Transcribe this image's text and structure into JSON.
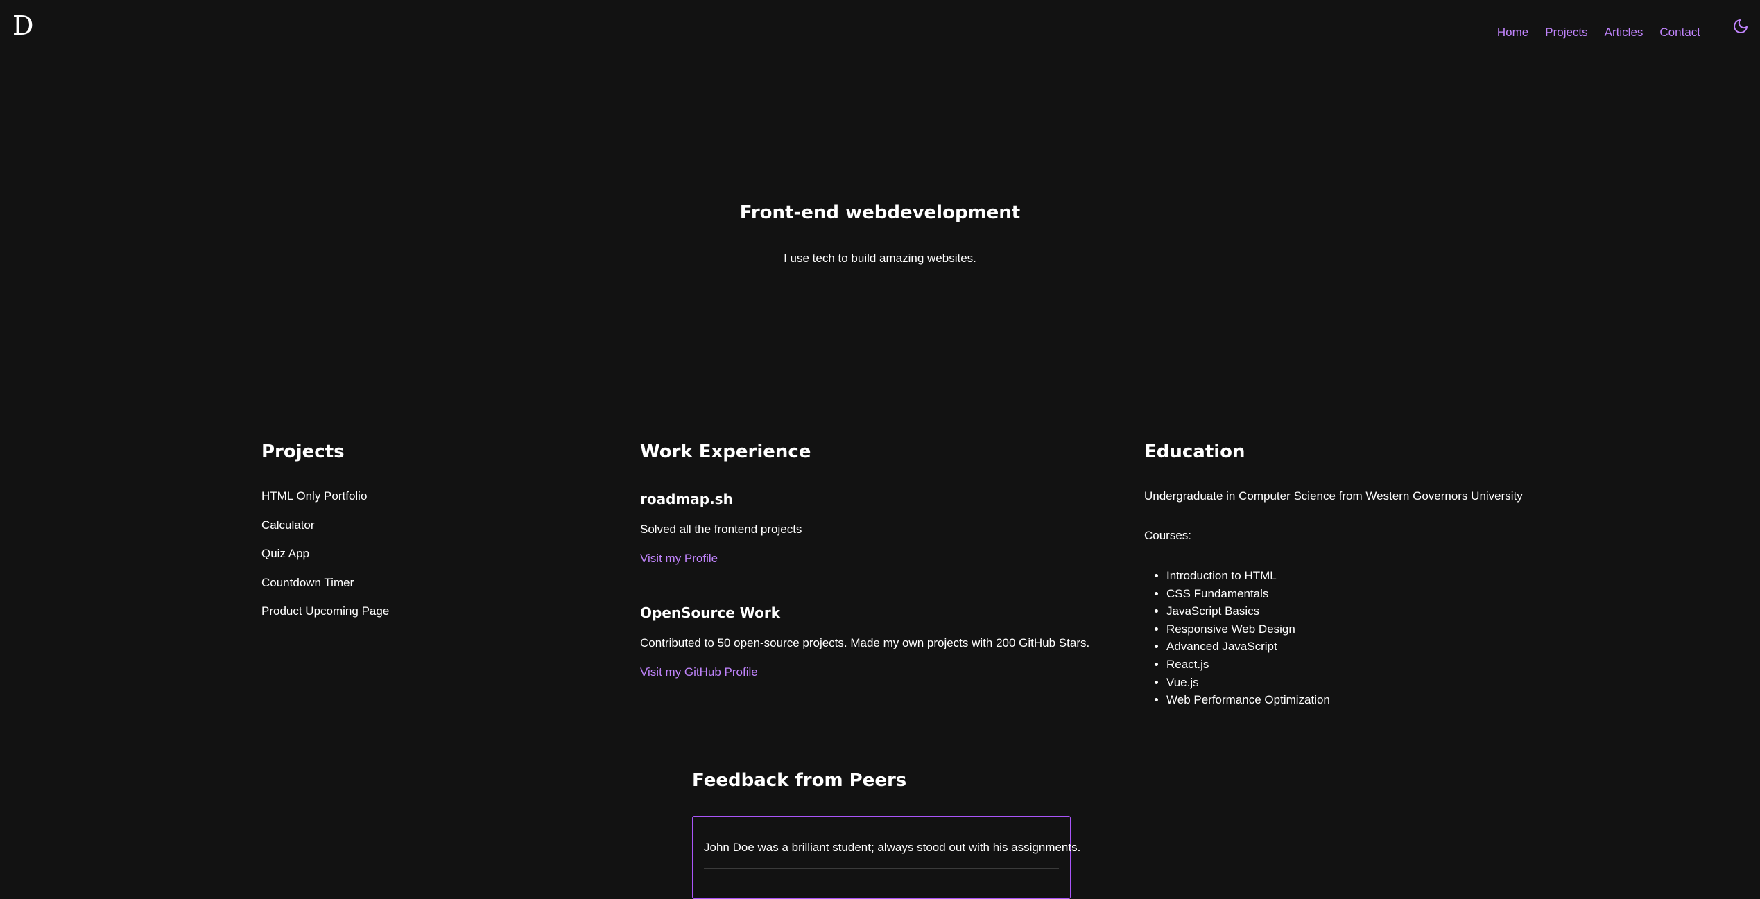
{
  "header": {
    "logo": "D",
    "nav": [
      "Home",
      "Projects",
      "Articles",
      "Contact"
    ],
    "theme_toggle_icon": "moon-icon"
  },
  "hero": {
    "title": "Front-end webdevelopment",
    "subtitle": "I use tech to build amazing websites."
  },
  "projects": {
    "heading": "Projects",
    "items": [
      "HTML Only Portfolio",
      "Calculator",
      "Quiz App",
      "Countdown Timer",
      "Product Upcoming Page"
    ]
  },
  "work": {
    "heading": "Work Experience",
    "entries": [
      {
        "title": "roadmap.sh",
        "description": "Solved all the frontend projects",
        "link": "Visit my Profile"
      },
      {
        "title": "OpenSource Work",
        "description": "Contributed to 50 open-source projects. Made my own projects with 200 GitHub Stars.",
        "link": "Visit my GitHub Profile"
      }
    ]
  },
  "education": {
    "heading": "Education",
    "degree": "Undergraduate in Computer Science from Western Governors University",
    "courses_label": "Courses:",
    "courses": [
      "Introduction to HTML",
      "CSS Fundamentals",
      "JavaScript Basics",
      "Responsive Web Design",
      "Advanced JavaScript",
      "React.js",
      "Vue.js",
      "Web Performance Optimization"
    ]
  },
  "feedback": {
    "heading": "Feedback from Peers",
    "quotes": [
      "John Doe was a brilliant student; always stood out with his assignments."
    ]
  },
  "colors": {
    "background": "#121212",
    "accent": "#c084fc",
    "card_border": "#a855f7"
  }
}
